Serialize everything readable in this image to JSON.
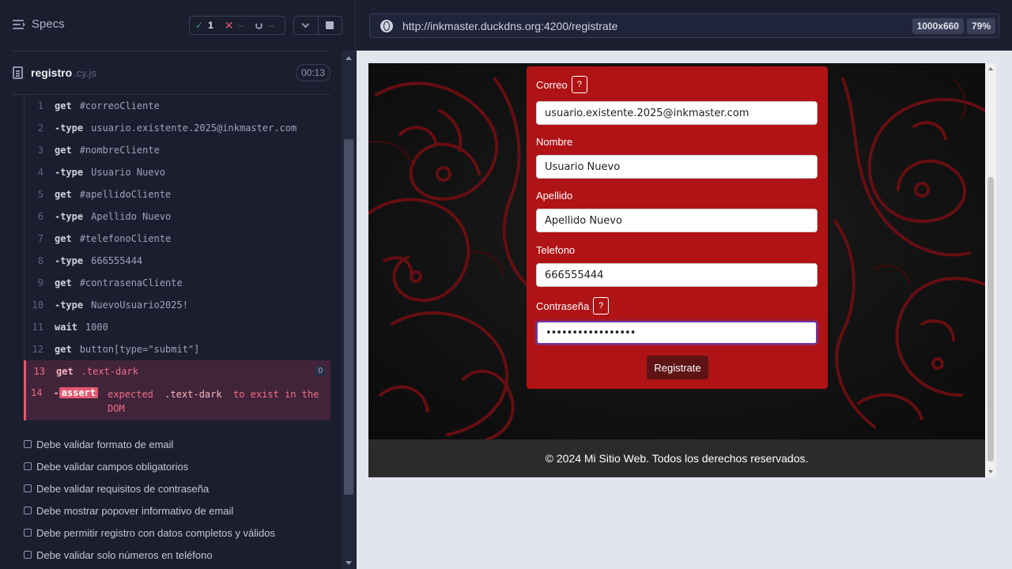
{
  "runner": {
    "specs_label": "Specs",
    "stats": {
      "passed": "1",
      "failed": "--",
      "pending": "--"
    },
    "spec": {
      "name": "registro",
      "ext": ".cy.js",
      "timer": "00:13"
    },
    "commands": [
      {
        "num": "1",
        "name": "get",
        "arg": "#correoCliente"
      },
      {
        "num": "2",
        "name": "-type",
        "arg": "usuario.existente.2025@inkmaster.com"
      },
      {
        "num": "3",
        "name": "get",
        "arg": "#nombreCliente"
      },
      {
        "num": "4",
        "name": "-type",
        "arg": "Usuario Nuevo"
      },
      {
        "num": "5",
        "name": "get",
        "arg": "#apellidoCliente"
      },
      {
        "num": "6",
        "name": "-type",
        "arg": "Apellido Nuevo"
      },
      {
        "num": "7",
        "name": "get",
        "arg": "#telefonoCliente"
      },
      {
        "num": "8",
        "name": "-type",
        "arg": "666555444"
      },
      {
        "num": "9",
        "name": "get",
        "arg": "#contrasenaCliente"
      },
      {
        "num": "10",
        "name": "-type",
        "arg": "NuevoUsuario2025!"
      },
      {
        "num": "11",
        "name": "wait",
        "arg": "1000"
      },
      {
        "num": "12",
        "name": "get",
        "arg": "button[type=\"submit\"]"
      },
      {
        "num": "13",
        "name": "get",
        "arg": ".text-dark",
        "badge": "0"
      }
    ],
    "assert": {
      "num": "14",
      "dash": "-",
      "tag": "assert",
      "text1": "expected",
      "selector": ".text-dark",
      "text2": "to exist in the DOM"
    },
    "tests": [
      "Debe validar formato de email",
      "Debe validar campos obligatorios",
      "Debe validar requisitos de contraseña",
      "Debe mostrar popover informativo de email",
      "Debe permitir registro con datos completos y válidos",
      "Debe validar solo números en teléfono"
    ]
  },
  "browser": {
    "url": "http://inkmaster.duckdns.org:4200/registrate",
    "viewport": "1000x660",
    "zoom": "79%"
  },
  "app": {
    "form": {
      "correo_label": "Correo",
      "correo_value": "usuario.existente.2025@inkmaster.com",
      "nombre_label": "Nombre",
      "nombre_value": "Usuario Nuevo",
      "apellido_label": "Apellido",
      "apellido_value": "Apellido Nuevo",
      "telefono_label": "Telefono",
      "telefono_value": "666555444",
      "contrasena_label": "Contraseña",
      "contrasena_value": "•••••••••••••••••",
      "help_glyph": "?",
      "submit_label": "Registrate"
    },
    "footer": "© 2024 Mi Sitio Web. Todos los derechos reservados."
  }
}
